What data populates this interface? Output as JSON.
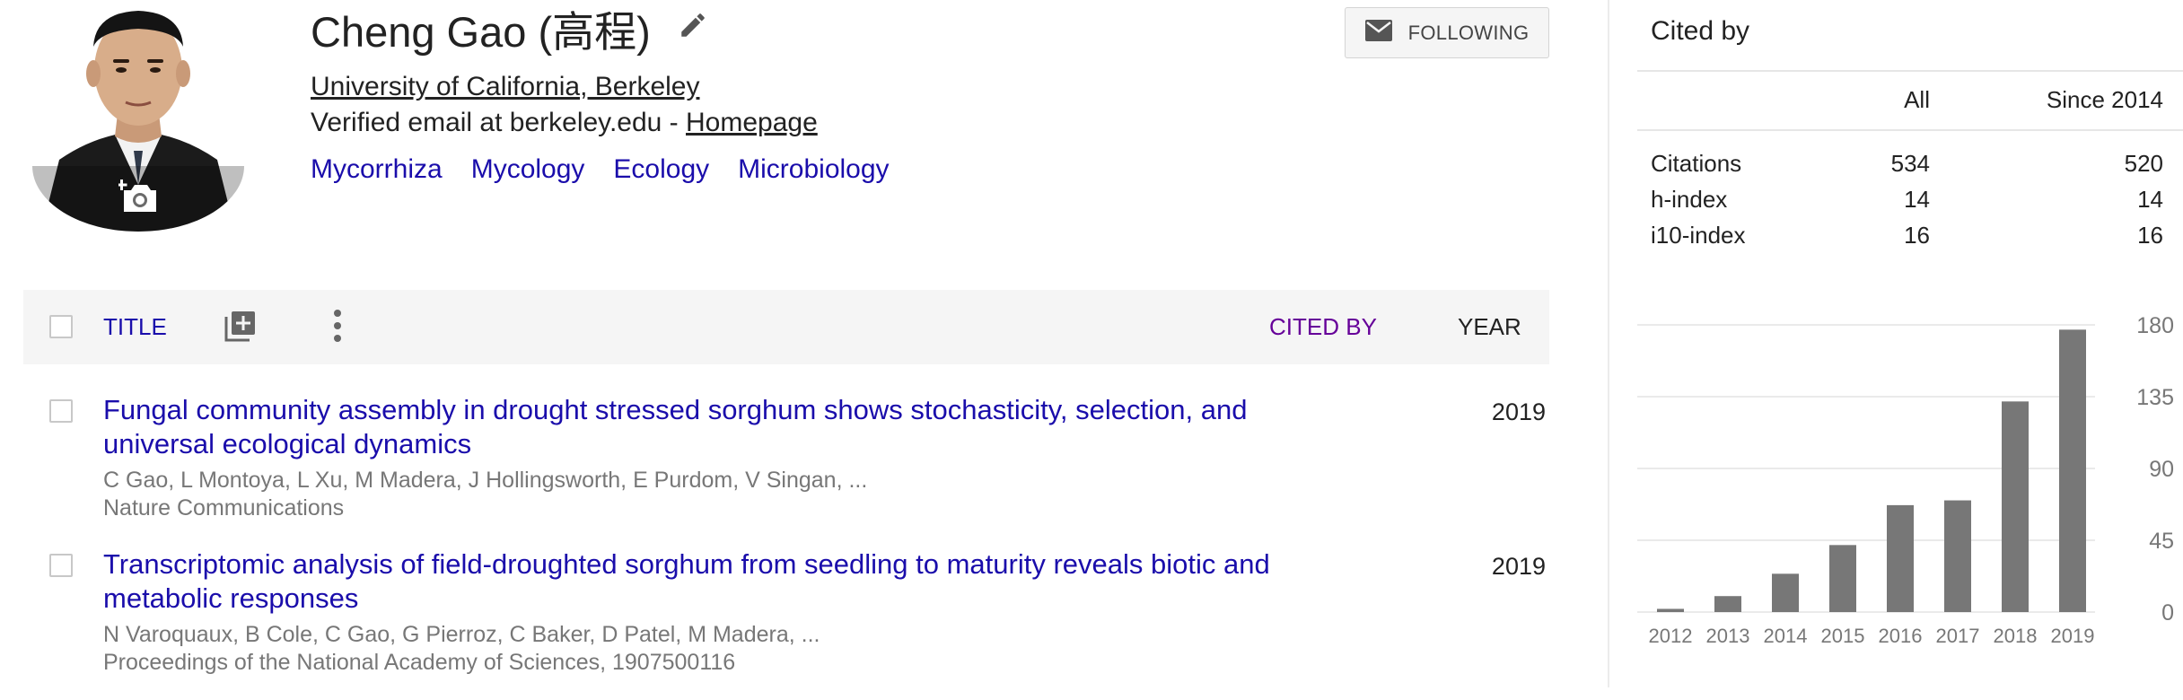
{
  "profile": {
    "name": "Cheng Gao (高程)",
    "affiliation": "University of California, Berkeley",
    "email_text": "Verified email at berkeley.edu - ",
    "homepage_label": "Homepage",
    "interests": [
      "Mycorrhiza",
      "Mycology",
      "Ecology",
      "Microbiology"
    ],
    "follow_label": "FOLLOWING"
  },
  "table": {
    "header": {
      "title": "TITLE",
      "cited_by": "CITED BY",
      "year": "YEAR"
    },
    "rows": [
      {
        "title": "Fungal community assembly in drought stressed sorghum shows stochasticity, selection, and universal ecological dynamics",
        "authors": "C Gao, L Montoya, L Xu, M Madera, J Hollingsworth, E Purdom, V Singan, ...",
        "venue": "Nature Communications",
        "year": "2019"
      },
      {
        "title": "Transcriptomic analysis of field-droughted sorghum from seedling to maturity reveals biotic and metabolic responses",
        "authors": "N Varoquaux, B Cole, C Gao, G Pierroz, C Baker, D Patel, M Madera, ...",
        "venue": "Proceedings of the National Academy of Sciences, 1907500116",
        "year": "2019"
      }
    ]
  },
  "cited_by": {
    "title": "Cited by",
    "col_all": "All",
    "col_since": "Since 2014",
    "rows": [
      {
        "label": "Citations",
        "all": "534",
        "since": "520"
      },
      {
        "label": "h-index",
        "all": "14",
        "since": "14"
      },
      {
        "label": "i10-index",
        "all": "16",
        "since": "16"
      }
    ]
  },
  "chart_data": {
    "type": "bar",
    "categories": [
      "2012",
      "2013",
      "2014",
      "2015",
      "2016",
      "2017",
      "2018",
      "2019"
    ],
    "values": [
      2,
      10,
      24,
      42,
      67,
      70,
      132,
      177
    ],
    "y_ticks": [
      "0",
      "45",
      "90",
      "135",
      "180"
    ],
    "ylim": [
      0,
      180
    ],
    "grid": true,
    "title": "",
    "xlabel": "",
    "ylabel": "",
    "bar_color": "#777777"
  },
  "colors": {
    "link": "#1a0dab",
    "cited_by_header": "#660099",
    "muted_text": "#777777",
    "header_bg": "#f5f5f5"
  },
  "icons": {
    "edit": "pencil-icon",
    "camera": "add-photo-icon",
    "follow": "envelope-icon",
    "add": "add-to-library-icon",
    "more": "more-vert-icon"
  }
}
